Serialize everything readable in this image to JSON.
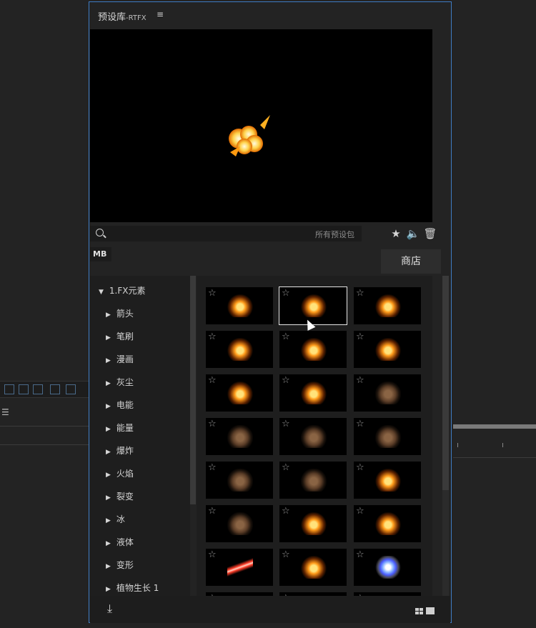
{
  "panel": {
    "title": "预设库",
    "title_suffix": "-RTFX",
    "menu_icon": "hamburger-icon"
  },
  "search": {
    "placeholder": "所有预设包",
    "icon": "search-icon"
  },
  "toolbar": {
    "favorite_icon": "star-icon",
    "sound_icon": "speaker-icon",
    "delete_icon": "trash-icon"
  },
  "tabs": {
    "active": "MB"
  },
  "shop_label": "商店",
  "tree": {
    "root": "1.FX元素",
    "items": [
      "箭头",
      "笔刷",
      "漫画",
      "灰尘",
      "电能",
      "能量",
      "爆炸",
      "火焰",
      "裂变",
      "冰",
      "液体",
      "变形",
      "植物生长 1"
    ]
  },
  "footer": {
    "download_icon": "download-icon",
    "grid_view_icon": "grid-view-icon",
    "large_view_icon": "large-view-icon"
  },
  "colors": {
    "panel_border": "#3e7cc4",
    "fire": "#ffb020",
    "smoke": "#6b4a32"
  }
}
